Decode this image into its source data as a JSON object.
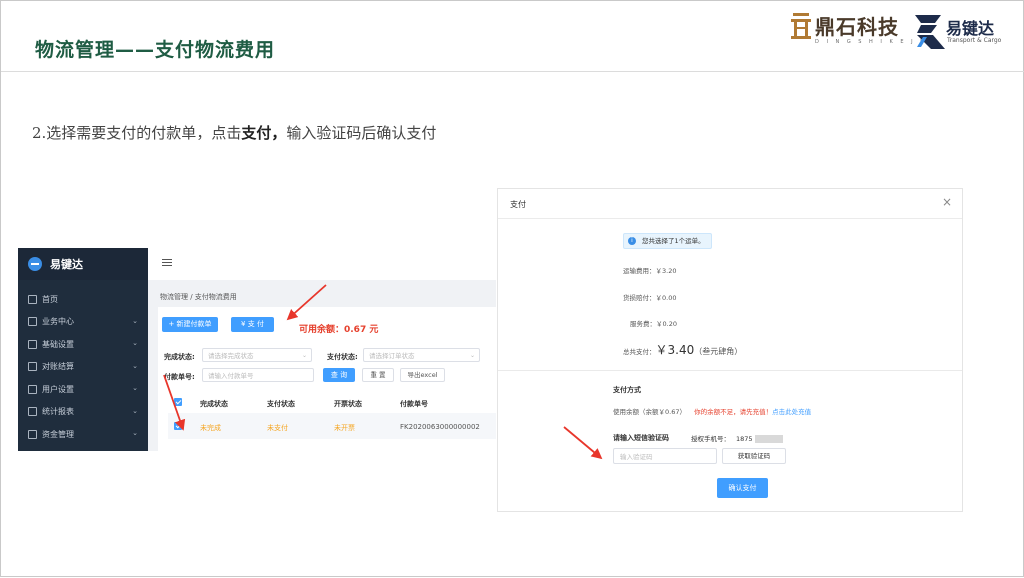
{
  "slide": {
    "title": "物流管理——支付物流费用",
    "step_prefix": "2.选择需要支付的付款单，点击",
    "step_bold": "支付，",
    "step_suffix": "输入验证码后确认支付"
  },
  "logos": {
    "logo1_name": "鼎石科技",
    "logo1_sub": "D I N G S H I K E J I",
    "logo2_name": "易键达",
    "logo2_sub": "Transport & Cargo"
  },
  "app": {
    "brand": "易键达",
    "sidebar": [
      {
        "label": "首页",
        "icon": "home-icon",
        "has_children": false
      },
      {
        "label": "业务中心",
        "icon": "business-icon",
        "has_children": true
      },
      {
        "label": "基础设置",
        "icon": "gear-icon",
        "has_children": true
      },
      {
        "label": "对账结算",
        "icon": "settlement-icon",
        "has_children": true
      },
      {
        "label": "用户设置",
        "icon": "user-icon",
        "has_children": true
      },
      {
        "label": "统计报表",
        "icon": "report-icon",
        "has_children": true
      },
      {
        "label": "资金管理",
        "icon": "wallet-icon",
        "has_children": true
      }
    ],
    "breadcrumb": "物流管理 / 支付物流费用",
    "new_payment_button": "+ 新建付款单",
    "pay_button": "¥ 支 付",
    "balance": "可用余额：0.67 元",
    "filters": {
      "complete_label": "完成状态:",
      "complete_placeholder": "请选择完成状态",
      "pay_label": "支付状态:",
      "pay_placeholder": "请选择订单状态",
      "number_label": "付款单号:",
      "number_placeholder": "请输入付款单号"
    },
    "query_button": "查 询",
    "reset_button": "重 置",
    "export_button": "导出excel",
    "table": {
      "headers": [
        "完成状态",
        "支付状态",
        "开票状态",
        "付款单号"
      ],
      "rows": [
        {
          "complete": "未完成",
          "pay": "未支付",
          "invoice": "未开票",
          "number": "FK2020063000000002"
        }
      ]
    }
  },
  "dialog": {
    "title": "支付",
    "close": "×",
    "notice": "您共选择了1个运单。",
    "freight": "运输费用：￥3.20",
    "damage": "货损赔付：￥0.00",
    "service": "服务费：￥0.20",
    "total_label": "总共支付：",
    "total_amount": "￥3.40",
    "total_words": "（叁元肆角）",
    "method_title": "支付方式",
    "balance_use": "使用余额（余额￥0.67）",
    "insufficient": "你的余额不足，请先充值！",
    "recharge_link": "点击此处充值",
    "sms_label": "请输入短信验证码",
    "phone_label": "授权手机号：",
    "phone_partial": "1875",
    "code_placeholder": "输入验证码",
    "get_code_button": "获取验证码",
    "confirm_button": "确认支付"
  },
  "colors": {
    "title_green": "#1f5c44",
    "accent_blue": "#409eff",
    "alert_red": "#e6402d",
    "sidebar_bg": "#1f2d3d",
    "status_orange": "#f5a623"
  }
}
